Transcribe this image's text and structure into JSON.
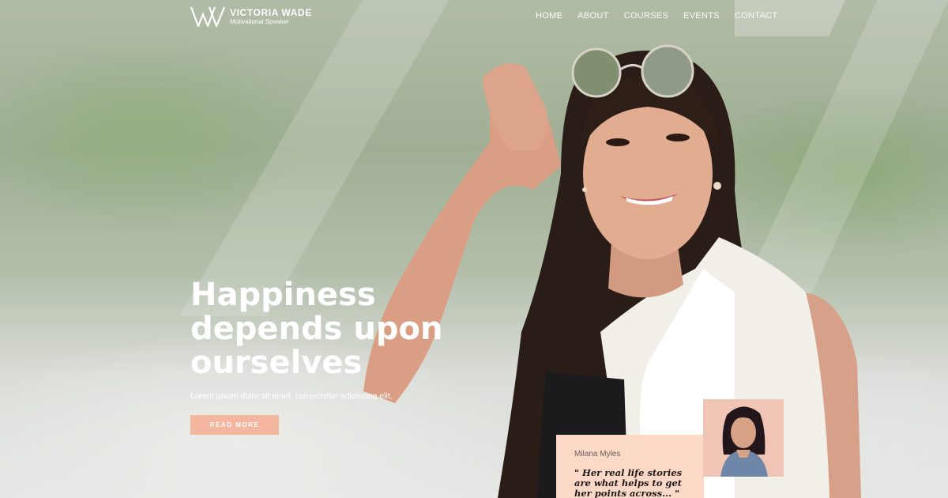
{
  "brand": {
    "name": "VICTORIA WADE",
    "tagline": "Motivational Speaker"
  },
  "nav": [
    {
      "label": "HOME",
      "active": true
    },
    {
      "label": "ABOUT",
      "active": false
    },
    {
      "label": "COURSES",
      "active": false
    },
    {
      "label": "EVENTS",
      "active": false
    },
    {
      "label": "CONTACT",
      "active": false
    }
  ],
  "hero": {
    "headline_lines": [
      "Happiness",
      "depends upon",
      "ourselves"
    ],
    "subtext": "Lorem ipsum dolor sit amet, consectetur adipiscing elit.",
    "button_label": "READ MORE"
  },
  "testimonial": {
    "name": "Milana Myles",
    "quote": "\" Her real life stories are what helps to get her points across... \""
  },
  "colors": {
    "accent": "#f5b6a0",
    "card_bg": "#fcd8c7",
    "text_light": "#ffffff"
  }
}
